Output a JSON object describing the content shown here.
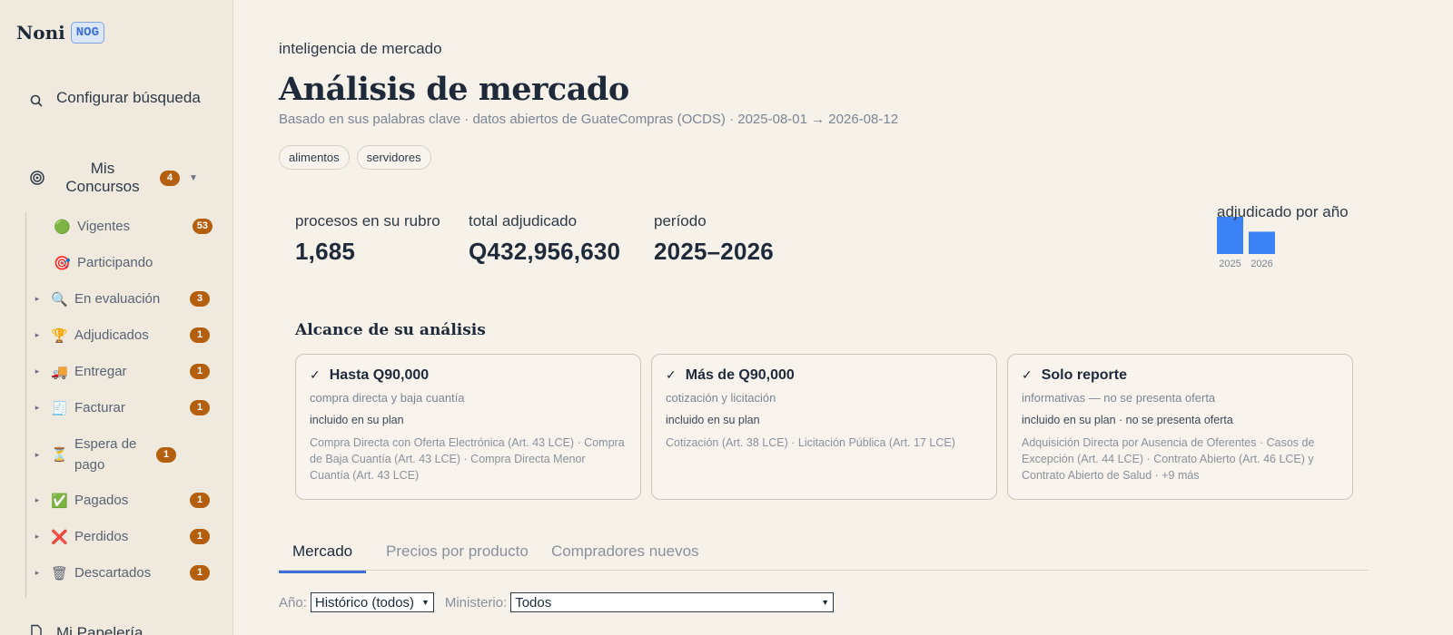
{
  "brand": {
    "name": "Noni",
    "badge": "NOG"
  },
  "sidebar": {
    "configure": "Configurar búsqueda",
    "mis_concursos": {
      "label": "Mis Concursos",
      "count": "4"
    },
    "items": [
      {
        "label": "Vigentes",
        "emoji": "🟢",
        "count": "53",
        "arrow": ""
      },
      {
        "label": "Participando",
        "emoji": "🎯",
        "count": "",
        "arrow": ""
      },
      {
        "label": "En evaluación",
        "emoji": "🔍",
        "count": "3",
        "arrow": "▸"
      },
      {
        "label": "Adjudicados",
        "emoji": "🏆",
        "count": "1",
        "arrow": "▸"
      },
      {
        "label": "Entregar",
        "emoji": "🚚",
        "count": "1",
        "arrow": "▸"
      },
      {
        "label": "Facturar",
        "emoji": "🧾",
        "count": "1",
        "arrow": "▸"
      },
      {
        "label": "Espera de pago",
        "emoji": "⏳",
        "count": "1",
        "arrow": "▸"
      },
      {
        "label": "Pagados",
        "emoji": "✅",
        "count": "1",
        "arrow": "▸"
      },
      {
        "label": "Perdidos",
        "emoji": "❌",
        "count": "1",
        "arrow": "▸"
      },
      {
        "label": "Descartados",
        "emoji": "🗑",
        "count": "1",
        "arrow": "▸"
      }
    ],
    "papeleria": "Mi Papelería"
  },
  "header": {
    "eyebrow": "inteligencia de mercado",
    "title": "Análisis de mercado",
    "subtitle": "Basado en sus palabras clave · datos abiertos de GuateCompras (OCDS) · 2025-08-01 → 2026-08-12",
    "keywords": [
      "alimentos",
      "servidores"
    ]
  },
  "stats": [
    {
      "label": "procesos en su rubro",
      "value": "1,685"
    },
    {
      "label": "total adjudicado",
      "value": "Q432,956,630"
    },
    {
      "label": "período",
      "value": "2025–2026"
    }
  ],
  "chart_data": {
    "type": "bar",
    "title": "adjudicado por año",
    "categories": [
      "2025",
      "2026"
    ],
    "values": [
      1.0,
      0.6
    ],
    "color": "#3b82f6"
  },
  "scope": {
    "title": "Alcance de su análisis",
    "cards": [
      {
        "check": "✓",
        "title": "Hasta Q90,000",
        "subtitle": "compra directa y baja cuantía",
        "included": "incluido en su plan",
        "detail": "Compra Directa con Oferta Electrónica (Art. 43 LCE) · Compra de Baja Cuantía (Art. 43 LCE) · Compra Directa Menor Cuantía (Art. 43 LCE)"
      },
      {
        "check": "✓",
        "title": "Más de Q90,000",
        "subtitle": "cotización y licitación",
        "included": "incluido en su plan",
        "detail": "Cotización (Art. 38 LCE) · Licitación Pública (Art. 17 LCE)"
      },
      {
        "check": "✓",
        "title": "Solo reporte",
        "subtitle": "informativas — no se presenta oferta",
        "included": "incluido en su plan · no se presenta oferta",
        "detail": "Adquisición Directa por Ausencia de Oferentes · Casos de Excepción (Art. 44 LCE) · Contrato Abierto (Art. 46 LCE) y Contrato Abierto de Salud · +9 más"
      }
    ]
  },
  "tabs": [
    "Mercado",
    "Precios por producto",
    "Compradores nuevos"
  ],
  "filters": {
    "year_label": "Año:",
    "year_value": "Histórico (todos)",
    "ministry_label": "Ministerio:",
    "ministry_value": "Todos"
  }
}
